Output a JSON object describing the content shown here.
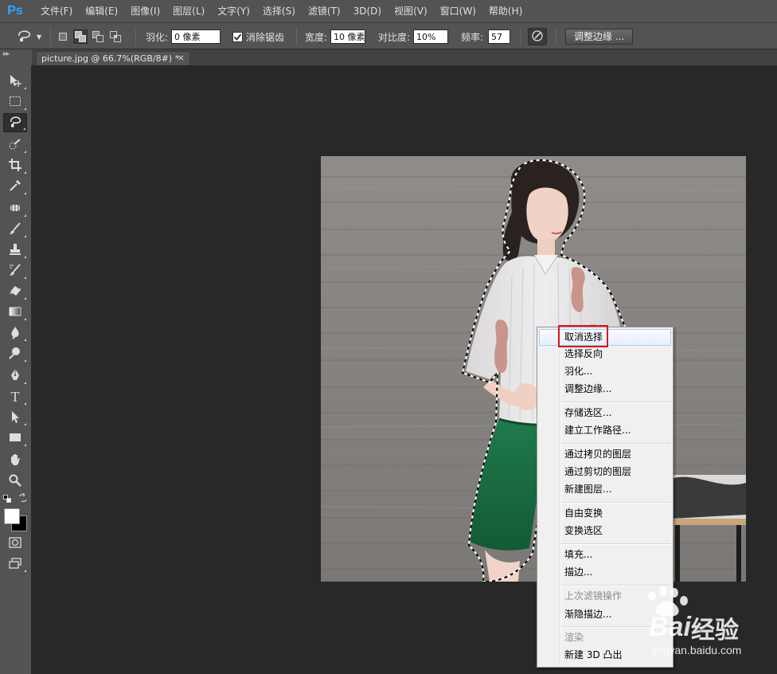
{
  "app": {
    "logo": "Ps"
  },
  "menubar": {
    "items": [
      "文件(F)",
      "编辑(E)",
      "图像(I)",
      "图层(L)",
      "文字(Y)",
      "选择(S)",
      "滤镜(T)",
      "3D(D)",
      "视图(V)",
      "窗口(W)",
      "帮助(H)"
    ]
  },
  "options": {
    "tool_icon": "magnetic-lasso-icon",
    "feather_label": "羽化:",
    "feather_value": "0 像素",
    "antialias_label": "消除锯齿",
    "antialias_checked": true,
    "width_label": "宽度:",
    "width_value": "10 像素",
    "contrast_label": "对比度:",
    "contrast_value": "10%",
    "frequency_label": "频率:",
    "frequency_value": "57",
    "pressure_icon": "tablet-pressure-icon",
    "refine_edge_label": "调整边缘 ..."
  },
  "document": {
    "tab_title": "picture.jpg @ 66.7%(RGB/8#) *",
    "close": "×"
  },
  "tools": [
    {
      "name": "move-tool-icon"
    },
    {
      "name": "rectangular-marquee-icon"
    },
    {
      "name": "magnetic-lasso-icon",
      "active": true
    },
    {
      "name": "quick-selection-icon"
    },
    {
      "name": "crop-icon"
    },
    {
      "name": "eyedropper-icon"
    },
    {
      "name": "spot-healing-icon"
    },
    {
      "name": "brush-icon"
    },
    {
      "name": "clone-stamp-icon"
    },
    {
      "name": "history-brush-icon"
    },
    {
      "name": "eraser-icon"
    },
    {
      "name": "gradient-icon"
    },
    {
      "name": "blur-icon"
    },
    {
      "name": "dodge-icon"
    },
    {
      "name": "pen-icon"
    },
    {
      "name": "type-icon",
      "glyph": "T"
    },
    {
      "name": "path-selection-icon"
    },
    {
      "name": "rectangle-shape-icon"
    },
    {
      "name": "hand-icon"
    },
    {
      "name": "zoom-icon"
    }
  ],
  "colors": {
    "foreground": "#ffffff",
    "background": "#000000"
  },
  "context_menu": {
    "items": [
      {
        "label": "取消选择",
        "highlighted": true
      },
      {
        "label": "选择反向"
      },
      {
        "label": "羽化..."
      },
      {
        "label": "调整边缘..."
      },
      {
        "separator": true
      },
      {
        "label": "存储选区..."
      },
      {
        "label": "建立工作路径..."
      },
      {
        "separator": true
      },
      {
        "label": "通过拷贝的图层"
      },
      {
        "label": "通过剪切的图层"
      },
      {
        "label": "新建图层..."
      },
      {
        "separator": true
      },
      {
        "label": "自由变换"
      },
      {
        "label": "变换选区"
      },
      {
        "separator": true
      },
      {
        "label": "填充..."
      },
      {
        "label": "描边..."
      },
      {
        "separator": true
      },
      {
        "label": "上次滤镜操作",
        "disabled": true
      },
      {
        "label": "渐隐描边..."
      },
      {
        "separator": true
      },
      {
        "label": "渲染",
        "disabled": true
      },
      {
        "label": "新建 3D 凸出"
      }
    ]
  },
  "watermark": {
    "brand": "Bai",
    "brand_cn": "经验",
    "url": "jingyan.baidu.com"
  }
}
